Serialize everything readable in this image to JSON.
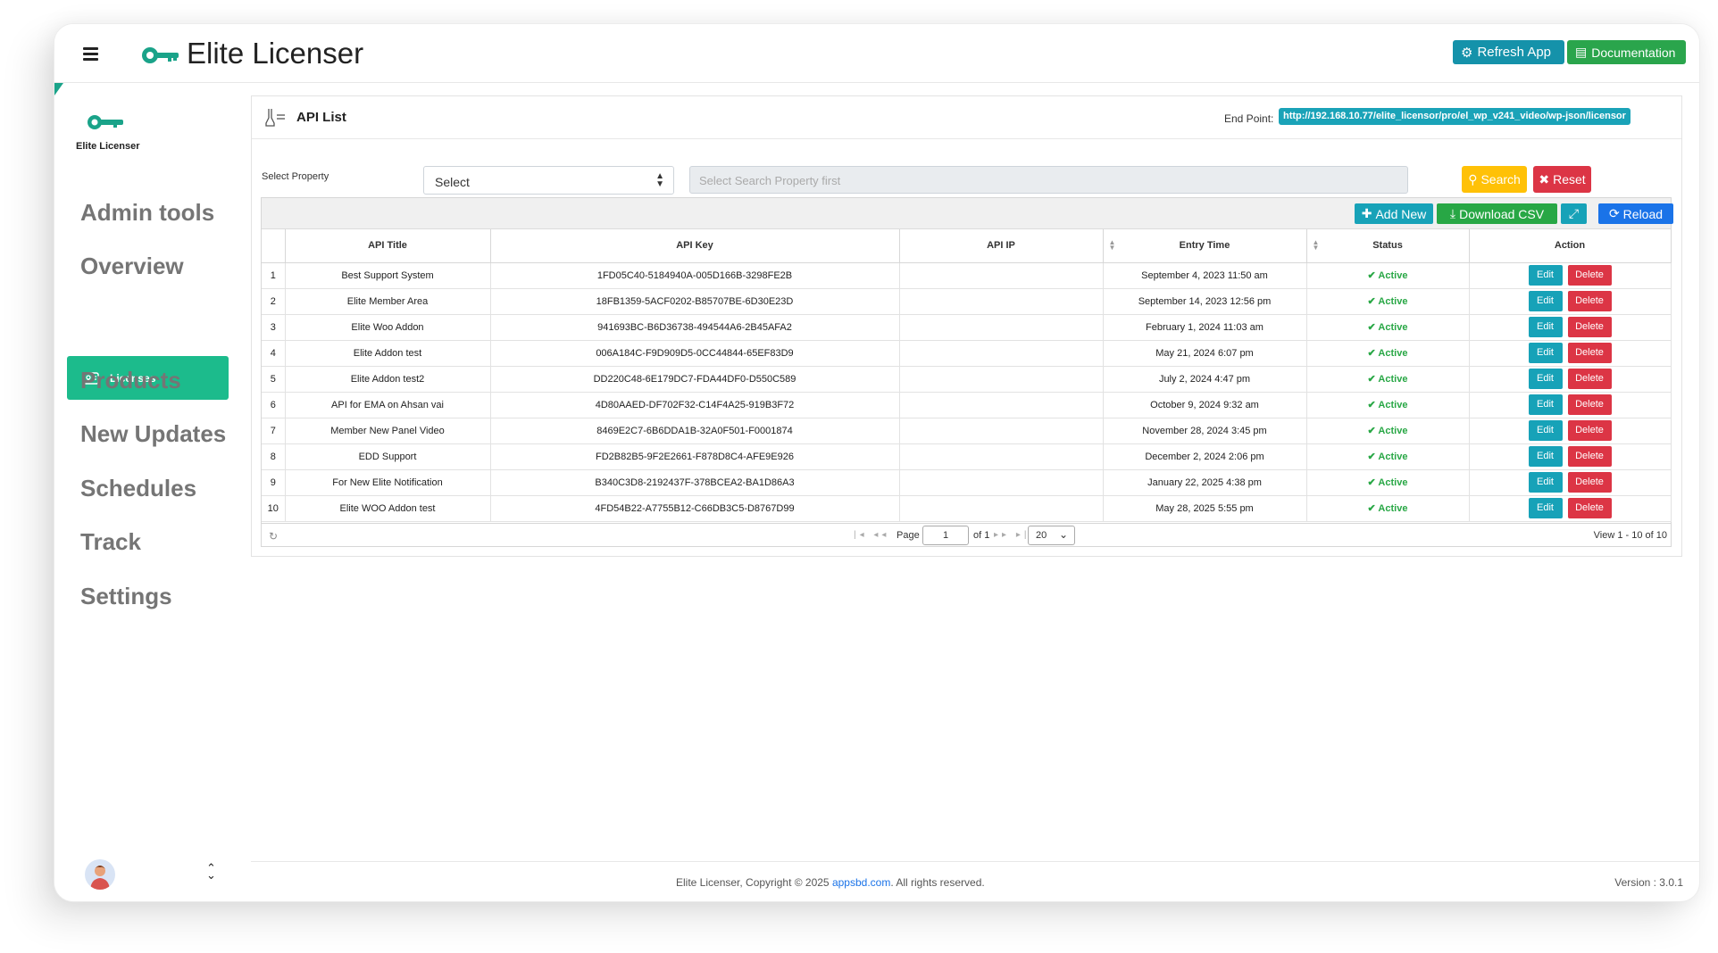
{
  "app": {
    "title": "Elite Licenser",
    "logo_label": "Elite Licenser"
  },
  "header": {
    "refresh_label": "Refresh App",
    "doc_label": "Documentation"
  },
  "sidebar": {
    "items": [
      {
        "label": "Admin tools"
      },
      {
        "label": "Overview"
      },
      {
        "label": "Licenses",
        "active": true
      },
      {
        "label": "Products"
      },
      {
        "label": "New Updates"
      },
      {
        "label": "Schedules"
      },
      {
        "label": "Track"
      },
      {
        "label": "Settings"
      }
    ]
  },
  "page": {
    "title": "API List",
    "endpoint_label": "End Point:",
    "endpoint_value": "http://192.168.10.77/elite_licensor/pro/el_wp_v241_video/wp-json/licensor"
  },
  "filter": {
    "property_label": "Select Property",
    "property_value": "Select",
    "search_placeholder": "Select Search Property first",
    "search_label": "Search",
    "reset_label": "Reset"
  },
  "toolbar": {
    "add_label": "Add New",
    "csv_label": "Download CSV",
    "reload_label": "Reload"
  },
  "table": {
    "columns": [
      "API Title",
      "API Key",
      "API IP",
      "Entry Time",
      "Status",
      "Action"
    ],
    "edit_label": "Edit",
    "delete_label": "Delete",
    "rows": [
      {
        "n": "1",
        "title": "Best Support System",
        "key": "1FD05C40-5184940A-005D166B-3298FE2B",
        "ip": "",
        "time": "September 4, 2023 11:50 am",
        "status": "Active"
      },
      {
        "n": "2",
        "title": "Elite Member Area",
        "key": "18FB1359-5ACF0202-B85707BE-6D30E23D",
        "ip": "",
        "time": "September 14, 2023 12:56 pm",
        "status": "Active"
      },
      {
        "n": "3",
        "title": "Elite Woo Addon",
        "key": "941693BC-B6D36738-494544A6-2B45AFA2",
        "ip": "",
        "time": "February 1, 2024 11:03 am",
        "status": "Active"
      },
      {
        "n": "4",
        "title": "Elite Addon test",
        "key": "006A184C-F9D909D5-0CC44844-65EF83D9",
        "ip": "",
        "time": "May 21, 2024 6:07 pm",
        "status": "Active"
      },
      {
        "n": "5",
        "title": "Elite Addon test2",
        "key": "DD220C48-6E179DC7-FDA44DF0-D550C589",
        "ip": "",
        "time": "July 2, 2024 4:47 pm",
        "status": "Active"
      },
      {
        "n": "6",
        "title": "API for EMA on Ahsan vai",
        "key": "4D80AAED-DF702F32-C14F4A25-919B3F72",
        "ip": "",
        "time": "October 9, 2024 9:32 am",
        "status": "Active"
      },
      {
        "n": "7",
        "title": "Member New Panel Video",
        "key": "8469E2C7-6B6DDA1B-32A0F501-F0001874",
        "ip": "",
        "time": "November 28, 2024 3:45 pm",
        "status": "Active"
      },
      {
        "n": "8",
        "title": "EDD Support",
        "key": "FD2B82B5-9F2E2661-F878D8C4-AFE9E926",
        "ip": "",
        "time": "December 2, 2024 2:06 pm",
        "status": "Active"
      },
      {
        "n": "9",
        "title": "For New Elite Notification",
        "key": "B340C3D8-2192437F-378BCEA2-BA1D86A3",
        "ip": "",
        "time": "January 22, 2025 4:38 pm",
        "status": "Active"
      },
      {
        "n": "10",
        "title": "Elite WOO Addon test",
        "key": "4FD54B22-A7755B12-C66DB3C5-D8767D99",
        "ip": "",
        "time": "May 28, 2025 5:55 pm",
        "status": "Active"
      }
    ]
  },
  "pager": {
    "page_label": "Page",
    "page_value": "1",
    "of_label": "of 1",
    "page_size": "20",
    "view_label": "View 1 - 10 of 10"
  },
  "footer": {
    "copy_prefix": "Elite Licenser, Copyright © 2025",
    "copy_link": "appsbd.com",
    "copy_suffix": ". All rights reserved.",
    "version": "Version : 3.0.1"
  },
  "colors": {
    "accent": "#1cbb8c",
    "info": "#17a2b8",
    "success": "#28a745",
    "danger": "#dc3545",
    "warning": "#ffc107",
    "primary": "#1a73e8"
  },
  "icons": {
    "menu": "hamburger-icon",
    "brand": "key-icon",
    "refresh": "gear-icon",
    "doc": "document-icon",
    "license": "id-card-icon",
    "search": "search-icon",
    "reset": "close-icon",
    "add": "plus-icon",
    "csv": "download-icon",
    "expand": "expand-icon",
    "reload": "reload-icon",
    "status": "check-circle-icon"
  }
}
